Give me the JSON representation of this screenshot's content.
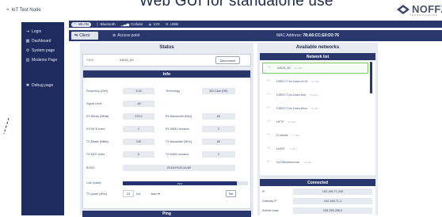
{
  "app": {
    "close_glyph": "×",
    "title": "IoT Test Node"
  },
  "headline": "Web GUI for standalone use",
  "logo": {
    "name": "NOFFZ",
    "sub": "TECHNOLOGIES"
  },
  "sidebar": {
    "items": [
      {
        "label": "Login",
        "icon": "login-icon",
        "glyph": "⇥"
      },
      {
        "label": "Dashboard",
        "icon": "dashboard-icon",
        "glyph": "▦"
      },
      {
        "label": "System page",
        "icon": "gear-icon",
        "glyph": "⚙"
      },
      {
        "label": "Modems Page",
        "icon": "modem-icon",
        "glyph": "▥"
      },
      {
        "label": "Debug page",
        "icon": "bug-icon",
        "glyph": "✱"
      }
    ]
  },
  "connection_bar": {
    "items": [
      {
        "label": "WLAN",
        "icon": "wifi-icon",
        "glyph": "◠"
      },
      {
        "label": "Bluetooth",
        "icon": "bluetooth-icon",
        "glyph": "ᛒ"
      },
      {
        "label": "Cellular",
        "icon": "cellular-icon",
        "glyph": "▁▃▅"
      },
      {
        "label": "V2X",
        "icon": "v2x-icon",
        "glyph": "⟁"
      },
      {
        "label": "UWB",
        "icon": "uwb-icon",
        "glyph": "≋"
      }
    ],
    "active": "WLAN"
  },
  "tabs": {
    "client": {
      "label": "Client",
      "icon": "client-icon",
      "glyph": "⇆"
    },
    "access_point": {
      "label": "Access point",
      "icon": "access-point-icon",
      "glyph": "⊛"
    },
    "mac_label": "MAC Address:",
    "mac_value": "78:A6:CC:E0:D2:76"
  },
  "status": {
    "title": "Status",
    "ssid_label": "SSID",
    "ssid_value": "ASUS_60",
    "disconnect_label": "Disconnect"
  },
  "info": {
    "title": "Info",
    "fields": {
      "frequency_label": "Frequency [GHz]",
      "frequency_value": "5.18",
      "technology_label": "Technology",
      "technology_value": "802.11ac (HE)",
      "signal_label": "Signal Level",
      "signal_value": "-46",
      "rx_bitrate_label": "RX Bitrate [MBits]",
      "rx_bitrate_value": "576.5",
      "rx_bandwidth_label": "RX Bandwidth [MHz]",
      "rx_bandwidth_value": "80",
      "rx_mcs_label": "RX MCS Index",
      "rx_mcs_value": "2",
      "rx_mimo_label": "RX MIMO streams",
      "rx_mimo_value": "2",
      "tx_bitrate_label": "TX Bitrate [MBits]",
      "tx_bitrate_value": "240",
      "tx_bandwidth_label": "TX Bandwidth [MHz]",
      "tx_bandwidth_value": "80",
      "tx_mcs_label": "TX MCS Index",
      "tx_mcs_value": "5",
      "tx_mimo_label": "TX MIMO streams",
      "tx_mimo_value": "2",
      "bssid_label": "BSSID",
      "bssid_value": "00:E8:F6:83:3A:B0",
      "link_quality_label": "Link Quality",
      "link_quality_text": "91%",
      "link_quality_pct": 91,
      "tx_power_label": "TX power [dBm]",
      "tx_power_value": "23",
      "tx_power_unit": "Kdr",
      "tx_power_mode": "Auto ▾",
      "set_label": "Set"
    }
  },
  "ping": {
    "title": "Ping"
  },
  "networks": {
    "title": "Available networks",
    "list_title": "Network list",
    "items": [
      {
        "name": "ASUS_60",
        "strength": "-46 dBm"
      },
      {
        "name": "DIRECT-Ve-Dash-ef-91",
        "strength": "-57 dBm"
      },
      {
        "name": "DIRECT-Ve-Dash-fest",
        "strength": "-59 dBm"
      },
      {
        "name": "DIRECT-Ve-Dash-thick",
        "strength": "-63 dBm"
      },
      {
        "name": "NFTF",
        "strength": "-65 dBm"
      },
      {
        "name": "Fruthalls",
        "strength": "-71 dBm"
      },
      {
        "name": "NoFfZ",
        "strength": "-74 dBm"
      },
      {
        "name": "NoTiMobilemover",
        "strength": "-78 dBm"
      }
    ]
  },
  "connected": {
    "title": "Connected",
    "ip_label": "IP",
    "ip_value": "192.168.71.245",
    "gateway_label": "Gateway IP",
    "gateway_value": "192.168.71.1",
    "subnet_label": "Subnet mask",
    "subnet_value": "255.255.255.0"
  }
}
